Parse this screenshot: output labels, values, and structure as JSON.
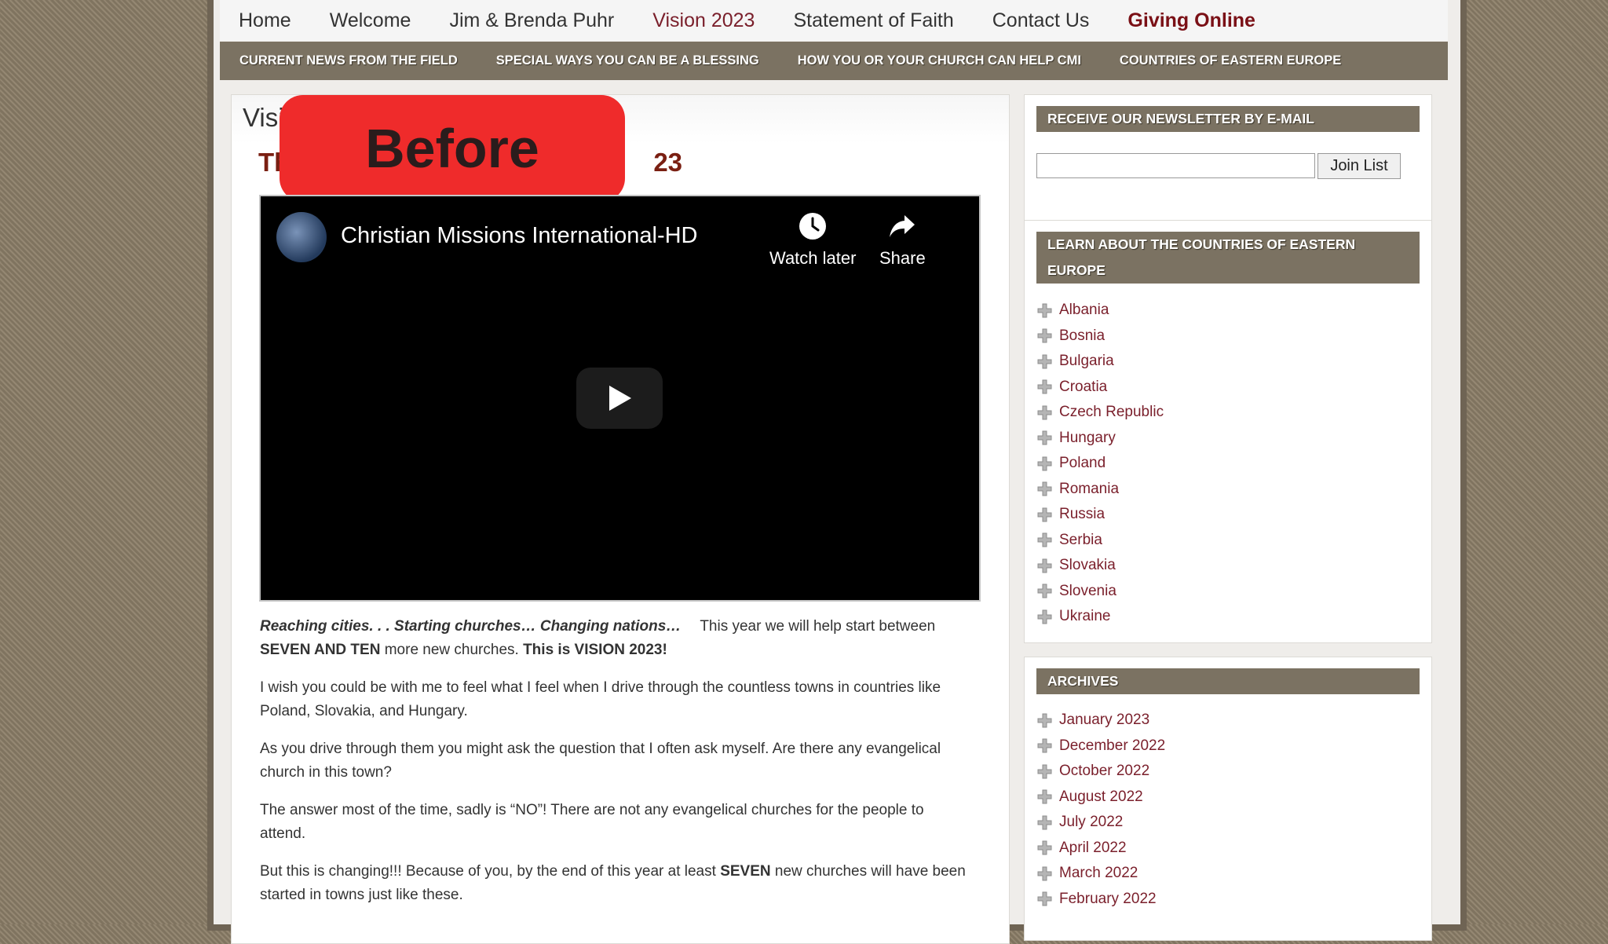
{
  "nav": {
    "main": [
      {
        "label": "Home"
      },
      {
        "label": "Welcome"
      },
      {
        "label": "Jim & Brenda Puhr"
      },
      {
        "label": "Vision 2023"
      },
      {
        "label": "Statement of Faith"
      },
      {
        "label": "Contact Us"
      },
      {
        "label": "Giving Online"
      }
    ],
    "sub": [
      {
        "label": "CURRENT NEWS FROM THE FIELD"
      },
      {
        "label": "SPECIAL WAYS YOU CAN BE A BLESSING"
      },
      {
        "label": "HOW YOU OR YOUR CHURCH CAN HELP CMI"
      },
      {
        "label": "COUNTRIES OF EASTERN EUROPE"
      }
    ]
  },
  "content": {
    "page_title_visible": "Visi",
    "post_title_left": "Th",
    "post_title_right": "23",
    "badge": "Before"
  },
  "video": {
    "channel_title": "Christian Missions International-HD",
    "watch_later": "Watch later",
    "share": "Share"
  },
  "article": {
    "p1_italic": "Reaching cities. . . Starting churches… Changing nations…",
    "p1_text": "This year we will help start between",
    "p1_bold": "SEVEN AND TEN",
    "p1_text2": "more new churches.",
    "p1_bold2": "This is VISION 2023!",
    "p2": "I wish you could be with me to feel what I feel when I drive through the countless towns in countries like Poland, Slovakia, and Hungary.",
    "p3": "As you drive through them you might ask the question that I often ask myself. Are there any evangelical church in this town?",
    "p4": "The answer most of the time, sadly is “NO”! There are not any evangelical churches for the people to attend.",
    "p5_a": "But this is changing!!! Because of you, by the end of this year at least",
    "p5_bold": "SEVEN",
    "p5_b": "new churches will have been started in towns just like these."
  },
  "sidebar": {
    "newsletter": {
      "title": "RECEIVE OUR NEWSLETTER BY E-MAIL",
      "button": "Join List"
    },
    "countries": {
      "title": "LEARN ABOUT THE COUNTRIES OF EASTERN EUROPE",
      "items": [
        "Albania",
        "Bosnia",
        "Bulgaria",
        "Croatia",
        "Czech Republic",
        "Hungary",
        "Poland",
        "Romania",
        "Russia",
        "Serbia",
        "Slovakia",
        "Slovenia",
        "Ukraine"
      ]
    },
    "archives": {
      "title": "ARCHIVES",
      "items": [
        "January 2023",
        "December 2022",
        "October 2022",
        "August 2022",
        "July 2022",
        "April 2022",
        "March 2022",
        "February 2022"
      ]
    }
  }
}
